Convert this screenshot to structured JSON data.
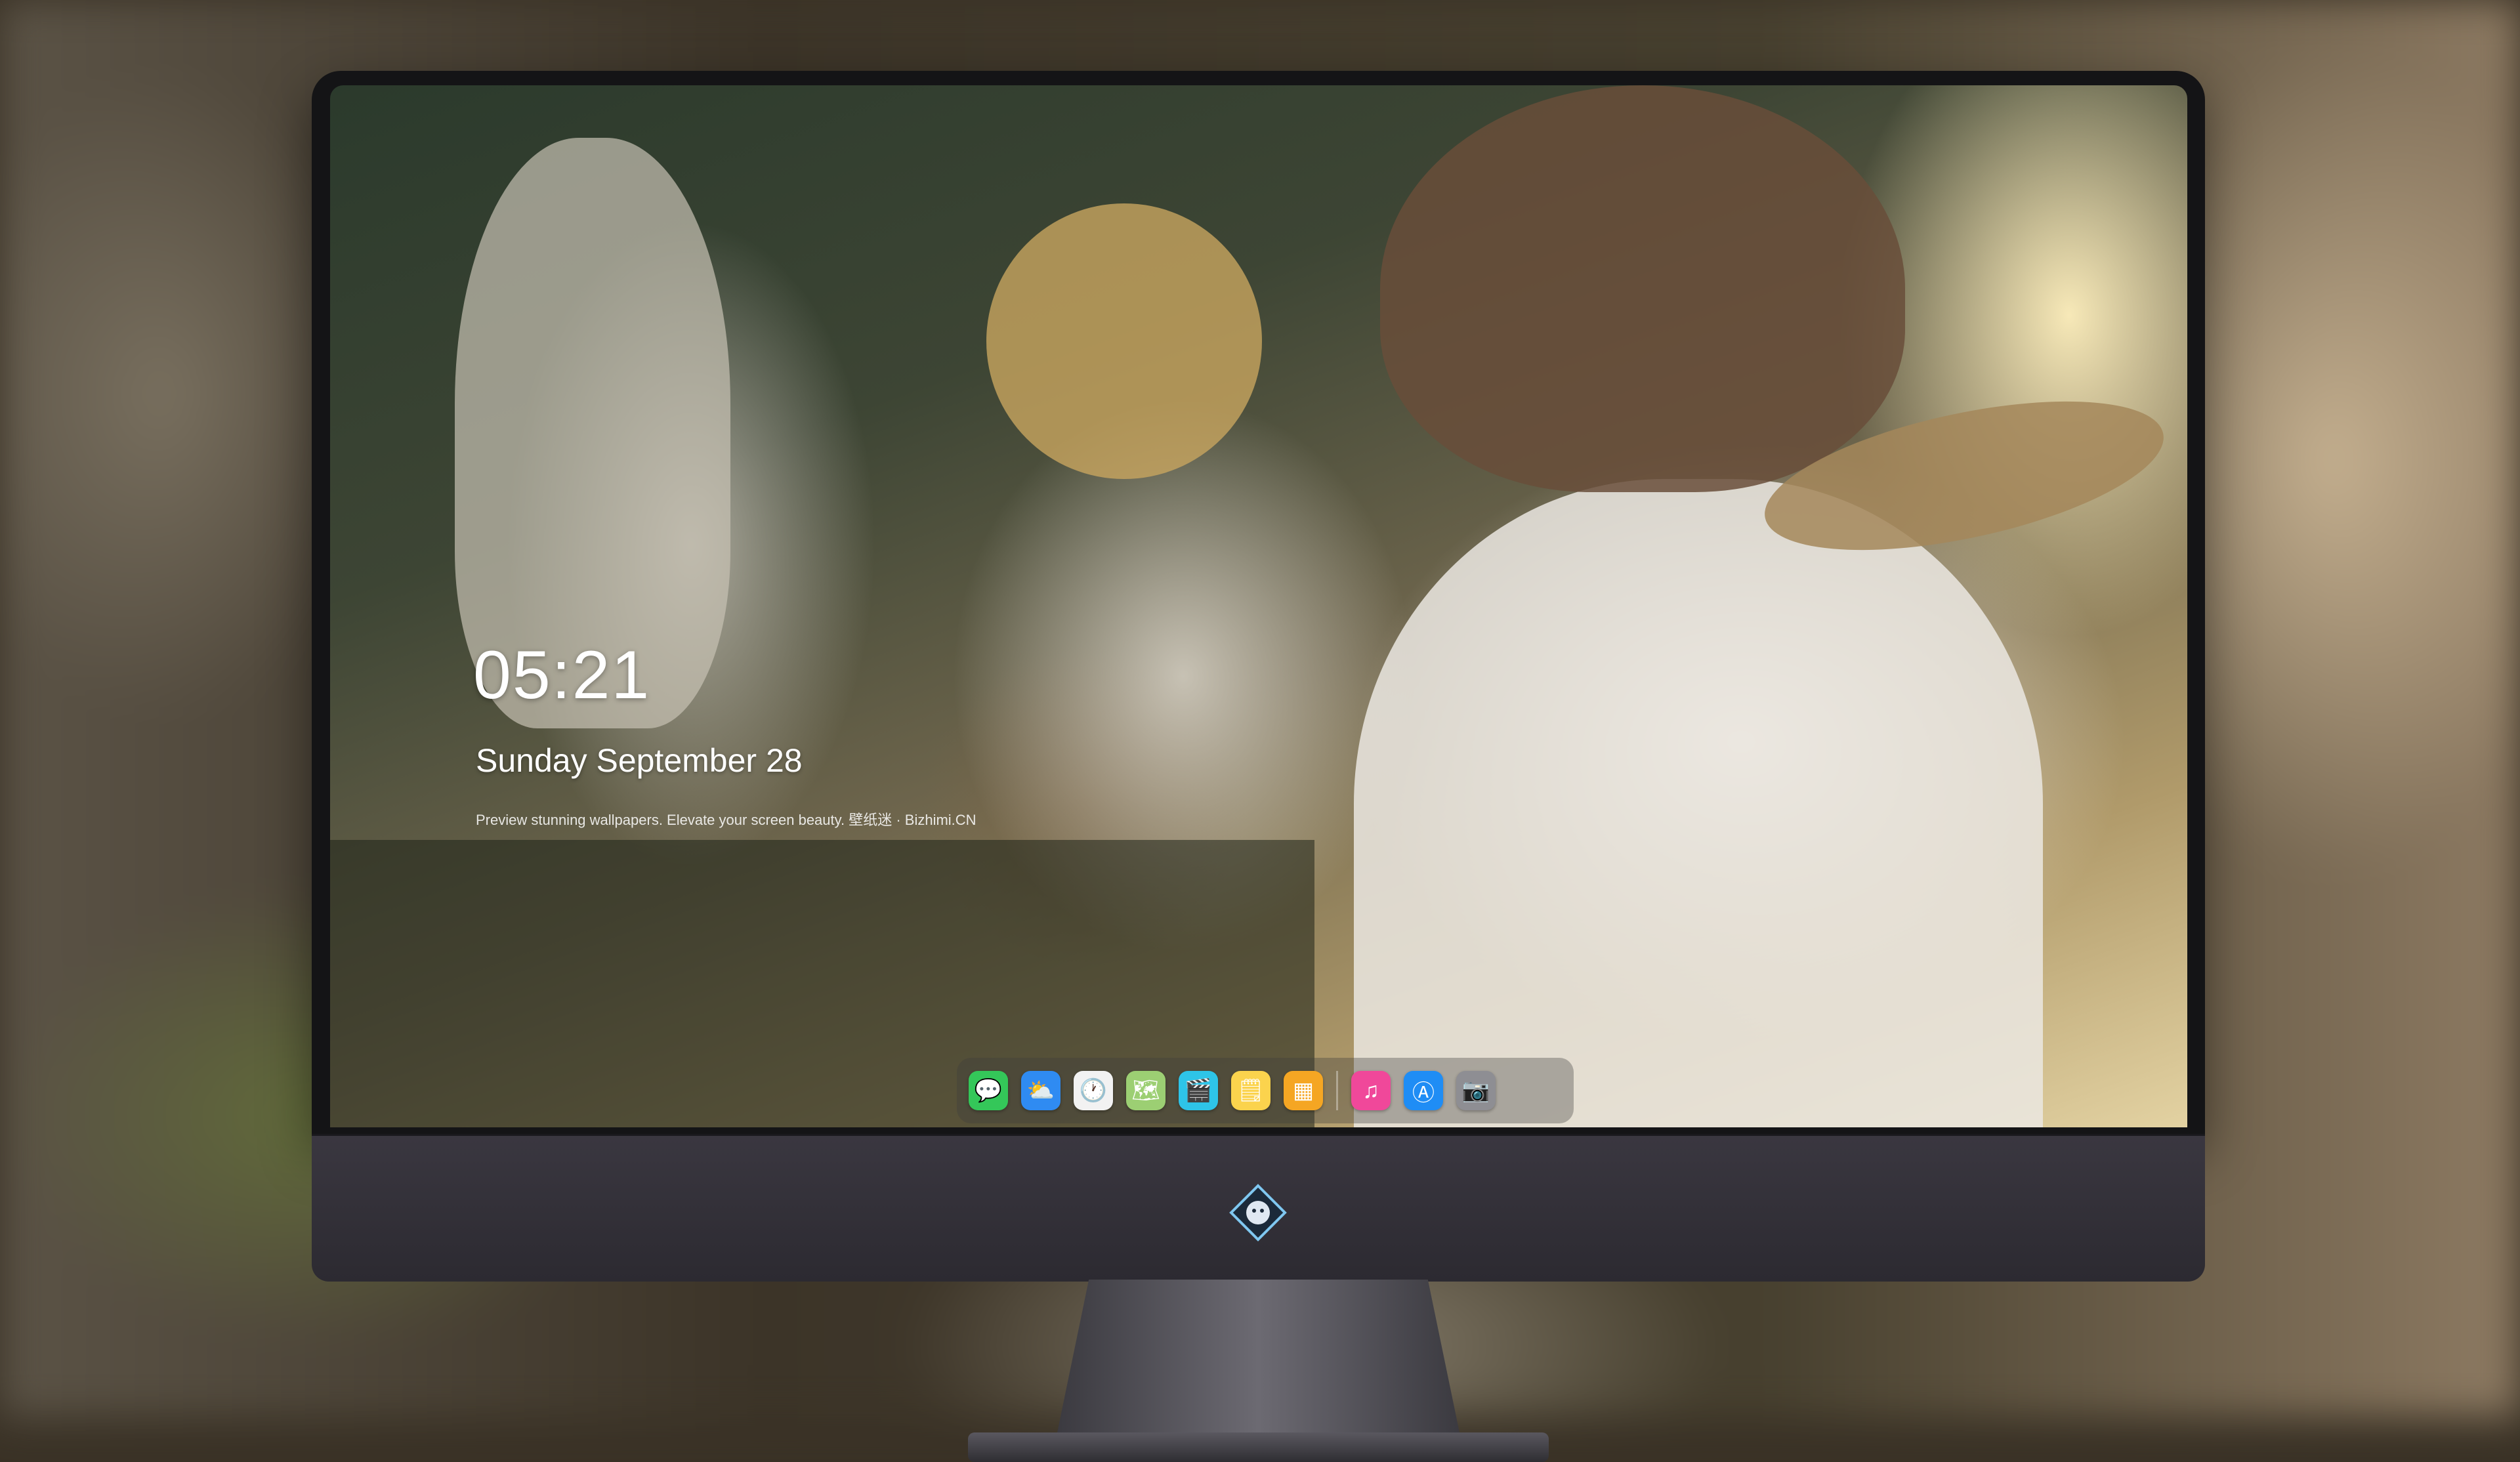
{
  "lockscreen": {
    "time": "05:21",
    "date": "Sunday September 28",
    "caption": "Preview stunning wallpapers. Elevate your screen beauty. 壁纸迷 · Bizhimi.CN"
  },
  "dock": {
    "apps": [
      {
        "name": "messages-icon",
        "glyph": "💬",
        "color": "#34c759"
      },
      {
        "name": "weather-icon",
        "glyph": "⛅",
        "color": "#2f8bf2"
      },
      {
        "name": "clock-icon",
        "glyph": "🕐",
        "color": "#f2f2f2"
      },
      {
        "name": "maps-icon",
        "glyph": "🗺",
        "color": "#9ccf73"
      },
      {
        "name": "video-icon",
        "glyph": "🎬",
        "color": "#2ec4e8"
      },
      {
        "name": "notes-icon",
        "glyph": "🗒",
        "color": "#fbd34d"
      },
      {
        "name": "photos-icon",
        "glyph": "▦",
        "color": "#f5a623"
      }
    ],
    "recent": [
      {
        "name": "music-icon",
        "glyph": "♫",
        "color": "#f0489a"
      },
      {
        "name": "app-store-icon",
        "glyph": "Ⓐ",
        "color": "#1f8df5"
      },
      {
        "name": "camera-icon",
        "glyph": "📷",
        "color": "#8e8e93"
      }
    ]
  }
}
